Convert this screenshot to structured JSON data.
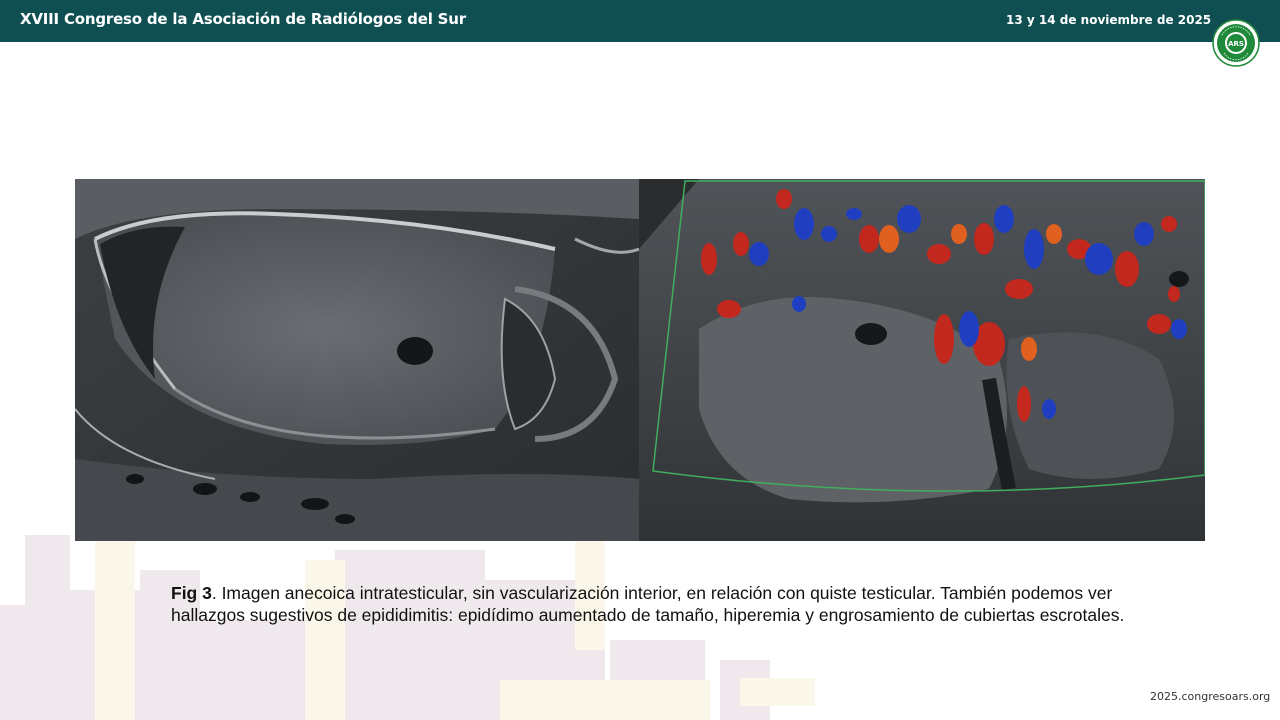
{
  "header": {
    "title": "XVIII Congreso de la Asociación de Radiólogos del Sur",
    "date": "13 y 14 de noviembre de 2025",
    "logo_text": "ARS",
    "logo_ring_text": "ASOCIACIÓN RADIÓLOGOS SUR",
    "bar_color": "#0f4f52",
    "logo_color": "#1f8a3a"
  },
  "figure": {
    "left_panel": "grayscale ultrasound",
    "right_panel": "color doppler ultrasound"
  },
  "caption": {
    "label": "Fig 3",
    "text": ". Imagen anecoica intratesticular, sin vascularización interior, en relación con quiste testicular. También podemos ver hallazgos sugestivos de epididimitis: epidídimo aumentado de tamaño, hiperemia y engrosamiento de cubiertas escrotales."
  },
  "footer": {
    "url": "2025.congresoars.org"
  }
}
